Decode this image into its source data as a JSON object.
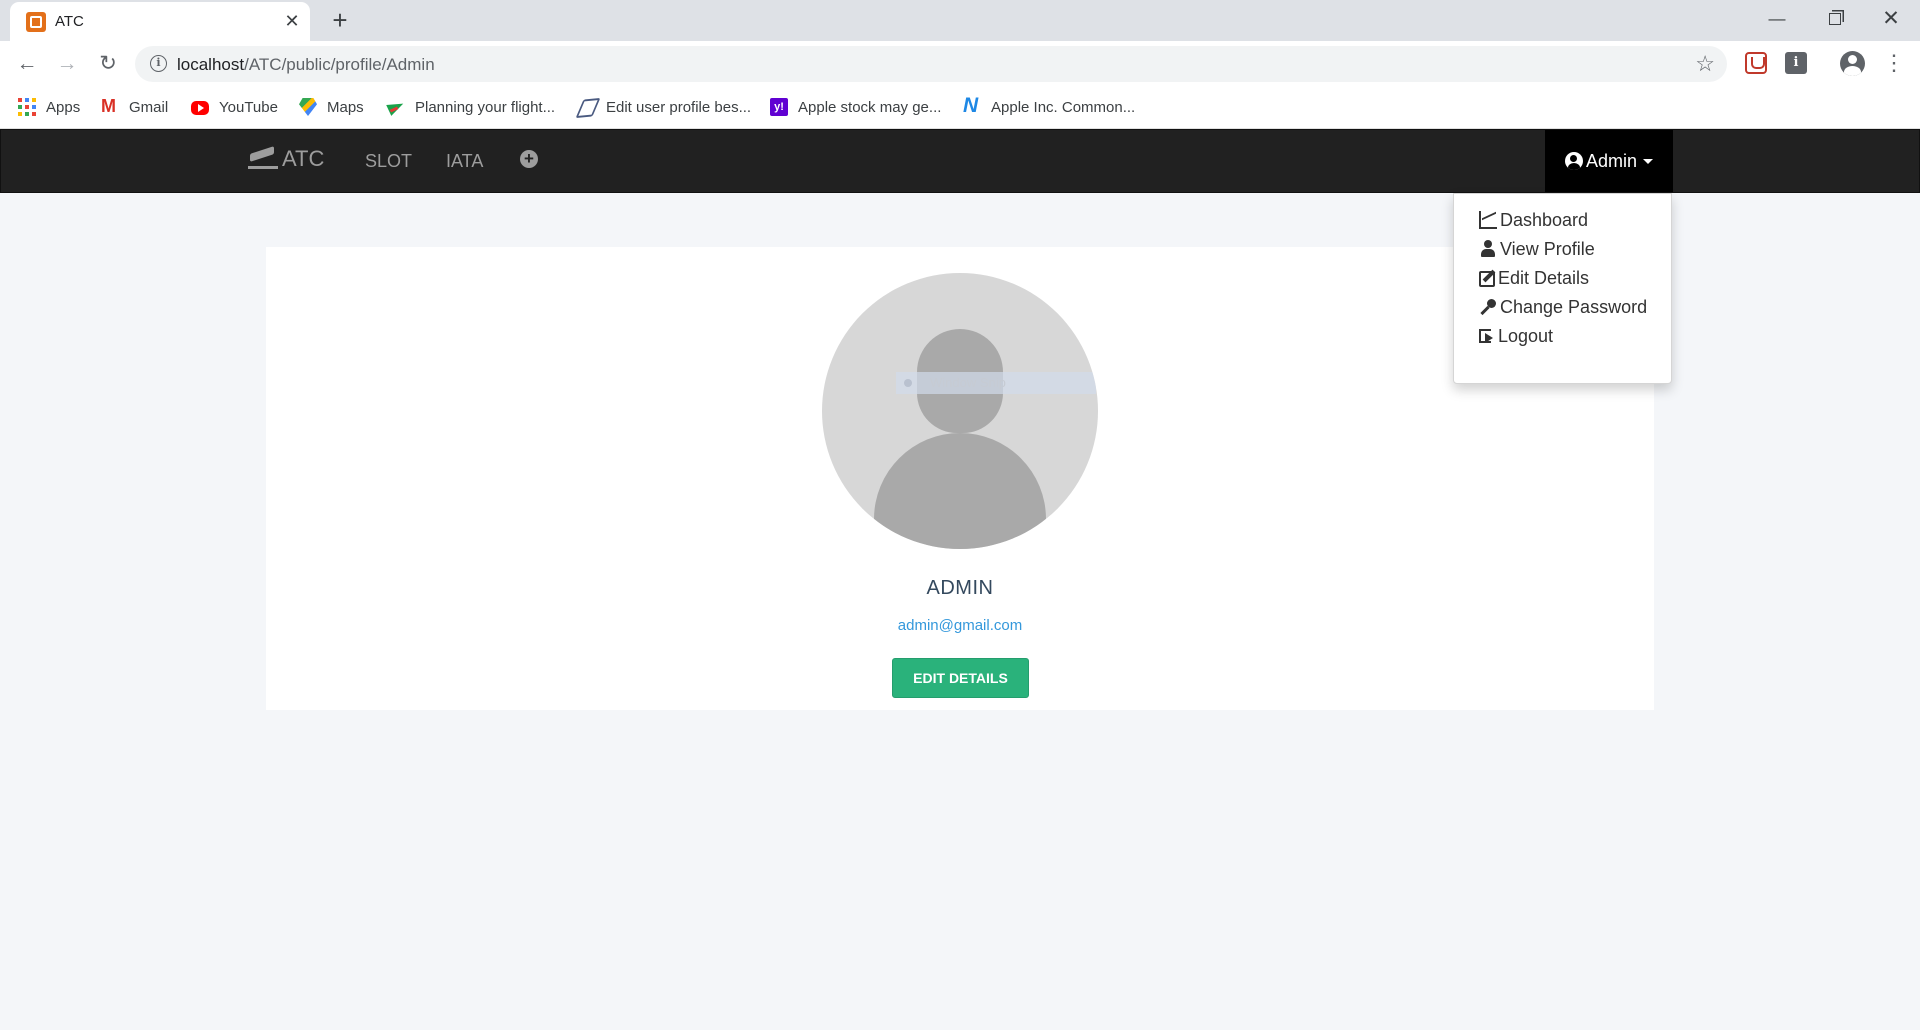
{
  "browser": {
    "tab_title": "ATC",
    "tab_close": "✕",
    "new_tab": "+",
    "url_host": "localhost",
    "url_path": "/ATC/public/profile/Admin",
    "bookmarks": [
      {
        "label": "Apps",
        "icon": "apps-grid-icon"
      },
      {
        "label": "Gmail",
        "icon": "gmail-icon"
      },
      {
        "label": "YouTube",
        "icon": "youtube-icon"
      },
      {
        "label": "Maps",
        "icon": "maps-icon"
      },
      {
        "label": "Planning your flight...",
        "icon": "plane-icon"
      },
      {
        "label": "Edit user profile bes...",
        "icon": "send-icon"
      },
      {
        "label": "Apple stock may ge...",
        "icon": "yahoo-icon"
      },
      {
        "label": "Apple Inc. Common...",
        "icon": "stock-icon"
      }
    ]
  },
  "navbar": {
    "brand": "ATC",
    "links": [
      "SLOT",
      "IATA"
    ],
    "user_label": "Admin"
  },
  "dropdown": {
    "items": [
      {
        "label": "Dashboard",
        "icon": "line-chart-icon"
      },
      {
        "label": "View Profile",
        "icon": "user-icon"
      },
      {
        "label": "Edit Details",
        "icon": "edit-icon"
      },
      {
        "label": "Change Password",
        "icon": "key-icon"
      },
      {
        "label": "Logout",
        "icon": "sign-out-icon"
      }
    ]
  },
  "profile": {
    "name": "ADMIN",
    "email": "admin@gmail.com",
    "edit_button": "EDIT DETAILS",
    "overlay_text": "Window Snip"
  },
  "colors": {
    "navbar_bg": "#212121",
    "button_green": "#2ab27b",
    "email_blue": "#3498db",
    "name_color": "#34495e"
  }
}
